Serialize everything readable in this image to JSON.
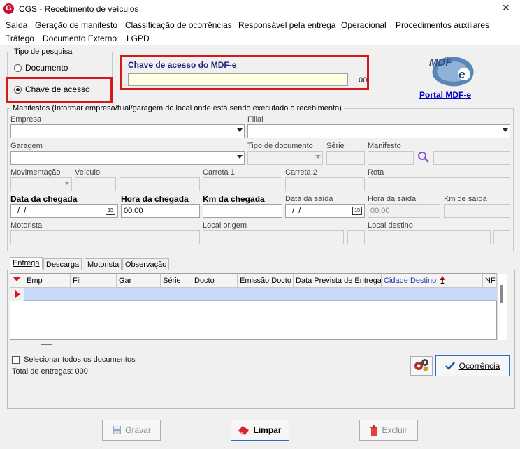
{
  "window": {
    "title": "CGS - Recebimento de veículos",
    "close": "✕"
  },
  "menu": [
    "Saída",
    "Geração de manifesto",
    "Classificação de ocorrências",
    "Responsável pela entrega",
    "Operacional",
    "Procedimentos auxiliares",
    "Tráfego",
    "Documento Externo",
    "LGPD"
  ],
  "search_type": {
    "title": "Tipo de pesquisa",
    "option1": "Documento",
    "option2": "Chave de acesso"
  },
  "mdfe": {
    "label": "Chave de acesso do MDF-e",
    "value": "",
    "suffix": "00",
    "portal": "Portal MDF-e",
    "logo_text": "MDF e"
  },
  "manifests": {
    "title": "Manifestos (Informar empresa/filial/garagem do local onde está sendo executado o recebimento)",
    "empresa": "Empresa",
    "filial": "Filial",
    "garagem": "Garagem",
    "tipo_doc": "Tipo de documento",
    "serie": "Série",
    "manifesto": "Manifesto",
    "movimentacao": "Movimentação",
    "veiculo": "Veículo",
    "carreta1": "Carreta 1",
    "carreta2": "Carreta 2",
    "rota": "Rota",
    "data_chegada": "Data da chegada",
    "hora_chegada": "Hora da chegada",
    "km_chegada": "Km da chegada",
    "data_saida": "Data da saída",
    "hora_saida": "Hora da saída",
    "km_saida": "Km de saída",
    "data_chegada_val": " /  /",
    "hora_chegada_val": "00:00",
    "data_saida_val": " /  /",
    "hora_saida_val": "00:00",
    "cal": "15",
    "motorista": "Motorista",
    "local_origem": "Local origem",
    "local_destino": "Local destino"
  },
  "tabs": [
    "Entrega",
    "Descarga",
    "Motorista",
    "Observação"
  ],
  "grid": {
    "columns": [
      "Emp",
      "Fil",
      "Gar",
      "Série",
      "Docto",
      "Emissão Docto",
      "Data Prevista de Entrega",
      "Cidade Destino",
      "NF"
    ],
    "sort_indicator": "1"
  },
  "footer": {
    "select_all": "Selecionar todos os documentos",
    "total": "Total de entregas: 000",
    "ocorrencia": "Ocorrência"
  },
  "buttons": {
    "gravar": "Gravar",
    "limpar": "Limpar",
    "excluir": "Excluir"
  },
  "colors": {
    "accent_red": "#d81818",
    "link_blue": "#0000cc",
    "field_yellow": "#ffffe1",
    "row_highlight": "#c8d8f8"
  }
}
